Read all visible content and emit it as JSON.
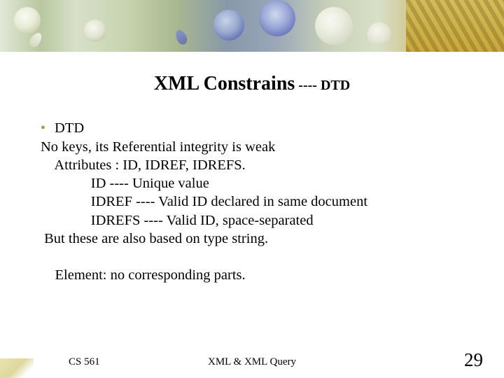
{
  "title": {
    "main": "XML Constrains",
    "dash": " ---- ",
    "sub": "DTD"
  },
  "bullet": {
    "heading": "DTD",
    "lines": [
      "No keys, its Referential integrity is weak",
      "    Attributes : ID, IDREF, IDREFS.",
      "              ID ---- Unique value",
      "              IDREF ---- Valid ID declared in same document",
      "              IDREFS ---- Valid ID, space-separated",
      " But these are also based on type string."
    ],
    "element_line": "    Element: no corresponding parts."
  },
  "footer": {
    "left": "CS 561",
    "center": "XML & XML Query",
    "page": "29"
  }
}
